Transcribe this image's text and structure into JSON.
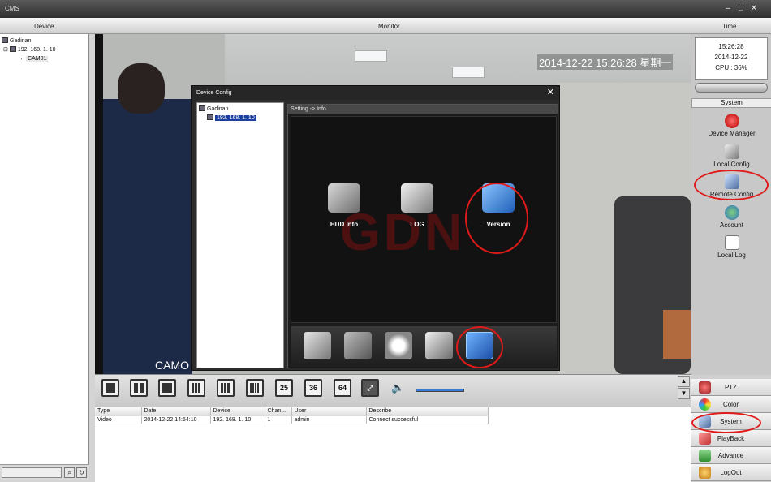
{
  "window": {
    "title": "CMS"
  },
  "header": {
    "device": "Device",
    "monitor": "Monitor",
    "time": "Time"
  },
  "device_tree": {
    "root": "Gadinan",
    "device": "192. 168. 1. 10",
    "camera": "CAM01"
  },
  "video": {
    "osd_datetime": "2014-12-22 15:26:28 星期一",
    "cam_label": "CAMO"
  },
  "dialog": {
    "title": "Device Config",
    "tree_root": "Gadinan",
    "tree_device": "192. 168. 1. 10",
    "breadcrumb": "Setting -> Info",
    "watermark": "GDN",
    "buttons": [
      "HDD Info",
      "LOG",
      "Version"
    ]
  },
  "status": {
    "time": "15:26:28",
    "date": "2014-12-22",
    "cpu": "CPU : 36%"
  },
  "system_panel": {
    "header": "System",
    "items": [
      "Device Manager",
      "Local Config",
      "Remote Config",
      "Account",
      "Local Log"
    ]
  },
  "toolbar": {
    "layouts": [
      "25",
      "36",
      "64"
    ]
  },
  "log": {
    "columns": [
      "Type",
      "Date",
      "Device",
      "Chan...",
      "User",
      "Describe"
    ],
    "rows": [
      [
        "Video",
        "2014-12-22 14:54:10",
        "192. 168. 1. 10",
        "1",
        "admin",
        "Connect successful"
      ]
    ]
  },
  "menu": [
    "PTZ",
    "Color",
    "System",
    "PlayBack",
    "Advance",
    "LogOut"
  ],
  "colors": {
    "highlight_ring": "#e01a1a",
    "accent": "#3a7bd5"
  }
}
